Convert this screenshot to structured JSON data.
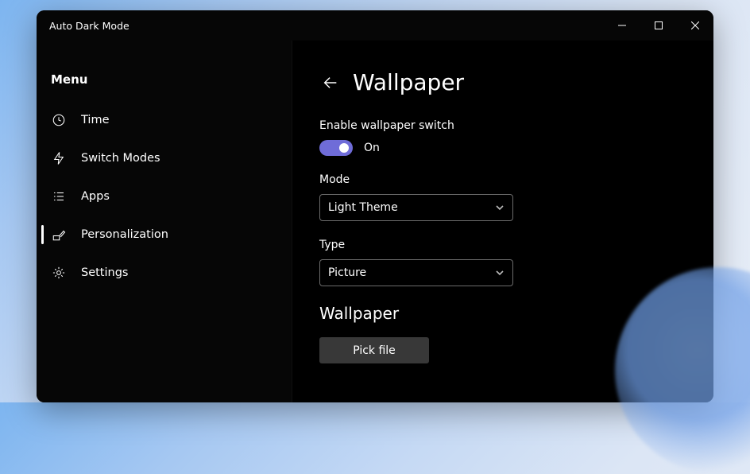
{
  "window": {
    "title": "Auto Dark Mode"
  },
  "sidebar": {
    "heading": "Menu",
    "items": [
      {
        "label": "Time"
      },
      {
        "label": "Switch Modes"
      },
      {
        "label": "Apps"
      },
      {
        "label": "Personalization"
      },
      {
        "label": "Settings"
      }
    ]
  },
  "page": {
    "title": "Wallpaper",
    "enable_switch_label": "Enable wallpaper switch",
    "toggle_state_label": "On",
    "mode_label": "Mode",
    "mode_value": "Light Theme",
    "type_label": "Type",
    "type_value": "Picture",
    "section_heading": "Wallpaper",
    "pick_button_label": "Pick file"
  },
  "colors": {
    "window_bg": "#000000",
    "accent_toggle": "#6f6cd8"
  }
}
